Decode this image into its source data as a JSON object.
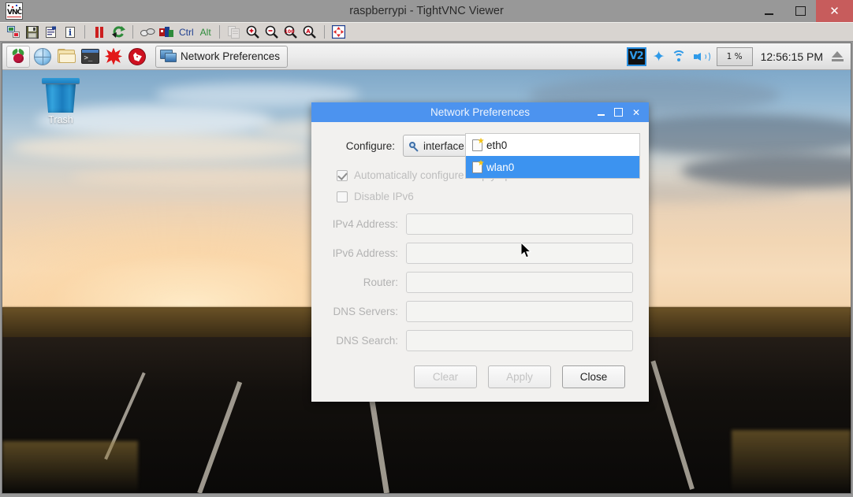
{
  "viewer": {
    "title": "raspberrypi - TightVNC Viewer",
    "app_icon": "vnc-logo-icon",
    "controls": {
      "minimize": "–",
      "maximize": "□",
      "close": "✕"
    },
    "toolbar": [
      {
        "name": "new-connection-icon",
        "label": "New connection"
      },
      {
        "name": "save-session-icon",
        "label": "Save session"
      },
      {
        "name": "connection-options-icon",
        "label": "Connection options"
      },
      {
        "name": "connection-info-icon",
        "label": "Connection info"
      },
      {
        "name": "pause-icon",
        "label": "Pause"
      },
      {
        "name": "refresh-icon",
        "label": "Request screen refresh"
      },
      {
        "name": "send-keys-icon",
        "label": "Send keys"
      },
      {
        "name": "ctrl-alt-del-icon",
        "label": "Send Ctrl-Alt-Del"
      },
      {
        "name": "ctrl-key-button",
        "label": "Ctrl"
      },
      {
        "name": "alt-key-button",
        "label": "Alt"
      },
      {
        "name": "clipboard-transfer-icon",
        "label": "Transfer clipboard"
      },
      {
        "name": "zoom-in-icon",
        "label": "Zoom in"
      },
      {
        "name": "zoom-out-icon",
        "label": "Zoom out"
      },
      {
        "name": "zoom-100-icon",
        "label": "Zoom 100%"
      },
      {
        "name": "zoom-auto-icon",
        "label": "Auto zoom"
      },
      {
        "name": "fullscreen-icon",
        "label": "Full screen"
      }
    ]
  },
  "taskbar": {
    "launchers": [
      {
        "name": "raspberry-menu-icon",
        "label": "Menu"
      },
      {
        "name": "web-browser-icon",
        "label": "Web Browser"
      },
      {
        "name": "file-manager-icon",
        "label": "File Manager"
      },
      {
        "name": "terminal-icon",
        "label": "Terminal"
      },
      {
        "name": "mathematica-icon",
        "label": "Mathematica"
      },
      {
        "name": "wolfram-icon",
        "label": "Wolfram"
      }
    ],
    "task_button": {
      "label": "Network Preferences",
      "icon": "network-preferences-icon"
    },
    "tray": {
      "vnc_label": "V2",
      "bluetooth_icon": "bluetooth-icon",
      "wifi_icon": "wifi-icon",
      "volume_icon": "volume-icon",
      "cpu_value": "1 %",
      "clock": "12:56:15 PM",
      "eject_icon": "eject-icon"
    }
  },
  "desktop": {
    "trash": {
      "label": "Trash",
      "icon": "trash-icon"
    }
  },
  "dialog": {
    "title": "Network Preferences",
    "controls": {
      "minimize": "–",
      "maximize": "□",
      "close": "✕"
    },
    "configure": {
      "label": "Configure:",
      "selected": "interface",
      "icon": "key-icon",
      "caret": "chevron-down-icon",
      "options": [
        {
          "label": "eth0",
          "selected": false,
          "icon": "interface-doc-icon"
        },
        {
          "label": "wlan0",
          "selected": true,
          "icon": "interface-doc-icon"
        }
      ]
    },
    "checkboxes": [
      {
        "label": "Automatically configure empty options",
        "checked": true,
        "disabled": true
      },
      {
        "label": "Disable IPv6",
        "checked": false,
        "disabled": true
      }
    ],
    "fields": [
      {
        "label": "IPv4 Address:",
        "value": "",
        "placeholder": ""
      },
      {
        "label": "IPv6 Address:",
        "value": "",
        "placeholder": ""
      },
      {
        "label": "Router:",
        "value": "",
        "placeholder": ""
      },
      {
        "label": "DNS Servers:",
        "value": "",
        "placeholder": ""
      },
      {
        "label": "DNS Search:",
        "value": "",
        "placeholder": ""
      }
    ],
    "buttons": [
      {
        "label": "Clear",
        "enabled": false
      },
      {
        "label": "Apply",
        "enabled": false
      },
      {
        "label": "Close",
        "enabled": true
      }
    ]
  },
  "colors": {
    "dialog_titlebar": "#4c93ef",
    "list_selection": "#3c93f0",
    "viewer_chrome": "#989898",
    "close_button": "#c75c5c",
    "tray_accent": "#2f9ae8"
  }
}
